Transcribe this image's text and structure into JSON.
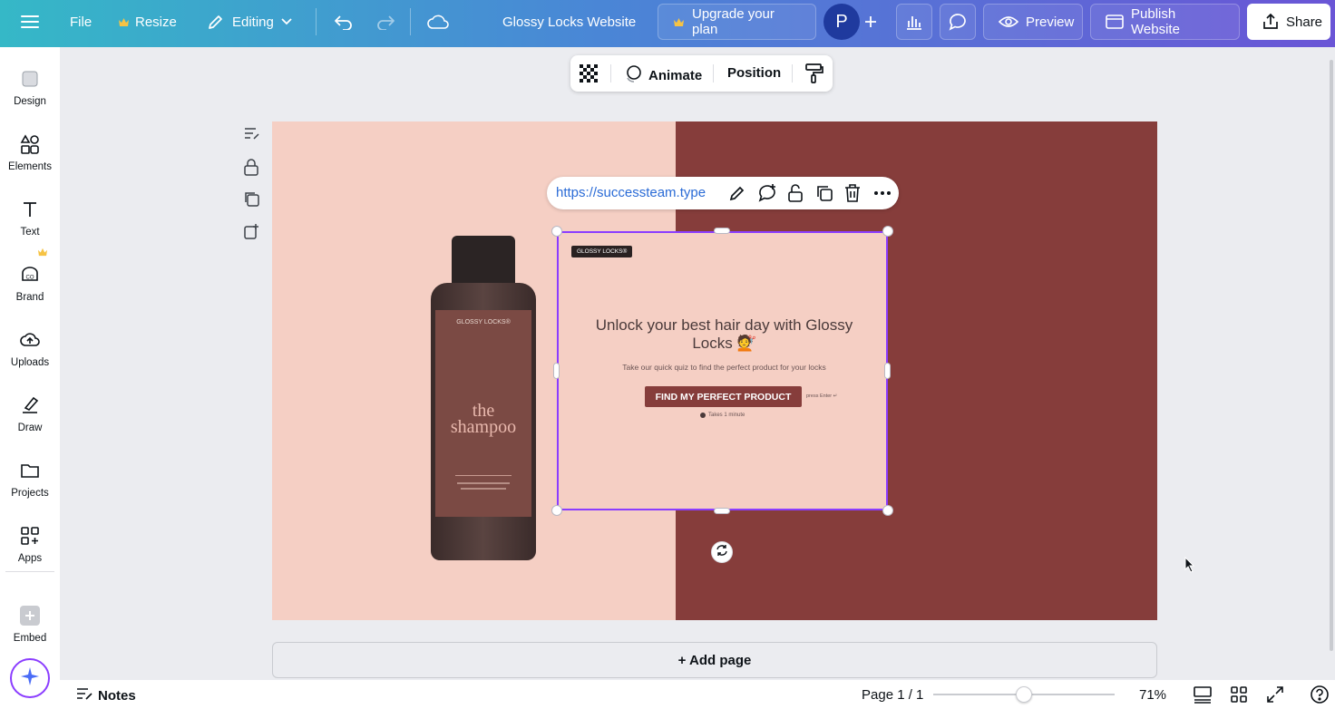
{
  "topbar": {
    "file_label": "File",
    "resize_label": "Resize",
    "editing_label": "Editing",
    "doc_title": "Glossy Locks Website",
    "upgrade_label": "Upgrade your plan",
    "avatar_initial": "P",
    "preview_label": "Preview",
    "publish_label": "Publish Website",
    "share_label": "Share"
  },
  "sidebar": {
    "items": [
      {
        "label": "Design",
        "icon": "design-icon"
      },
      {
        "label": "Elements",
        "icon": "elements-icon"
      },
      {
        "label": "Text",
        "icon": "text-icon"
      },
      {
        "label": "Brand",
        "icon": "brand-icon"
      },
      {
        "label": "Uploads",
        "icon": "uploads-icon"
      },
      {
        "label": "Draw",
        "icon": "draw-icon"
      },
      {
        "label": "Projects",
        "icon": "projects-icon"
      },
      {
        "label": "Apps",
        "icon": "apps-icon"
      },
      {
        "label": "Embed",
        "icon": "embed-icon"
      }
    ]
  },
  "toolbar": {
    "animate_label": "Animate",
    "position_label": "Position"
  },
  "linkbar": {
    "url": "https://successteam.type"
  },
  "bottle": {
    "brand": "GLOSSY LOCKS®",
    "name_line1": "the",
    "name_line2": "shampoo"
  },
  "embed": {
    "logo_text": "GLOSSY LOCKS®",
    "headline_line1": "Unlock your best hair day with Glossy",
    "headline_line2": "Locks 💇",
    "subtext": "Take our quick quiz to find the perfect product for your locks",
    "cta_label": "FIND MY PERFECT PRODUCT",
    "press_enter": "press Enter ↵",
    "takes_time": "Takes 1 minute"
  },
  "canvas": {
    "add_page_label": "+ Add page"
  },
  "bottom": {
    "notes_label": "Notes",
    "page_indicator": "Page 1 / 1",
    "zoom_label": "71%",
    "zoom_fraction": 0.5
  },
  "colors": {
    "accent": "#8b3dff",
    "page_pink": "#f5cfc4",
    "page_maroon": "#863d3b",
    "avatar": "#1f3a9e"
  }
}
